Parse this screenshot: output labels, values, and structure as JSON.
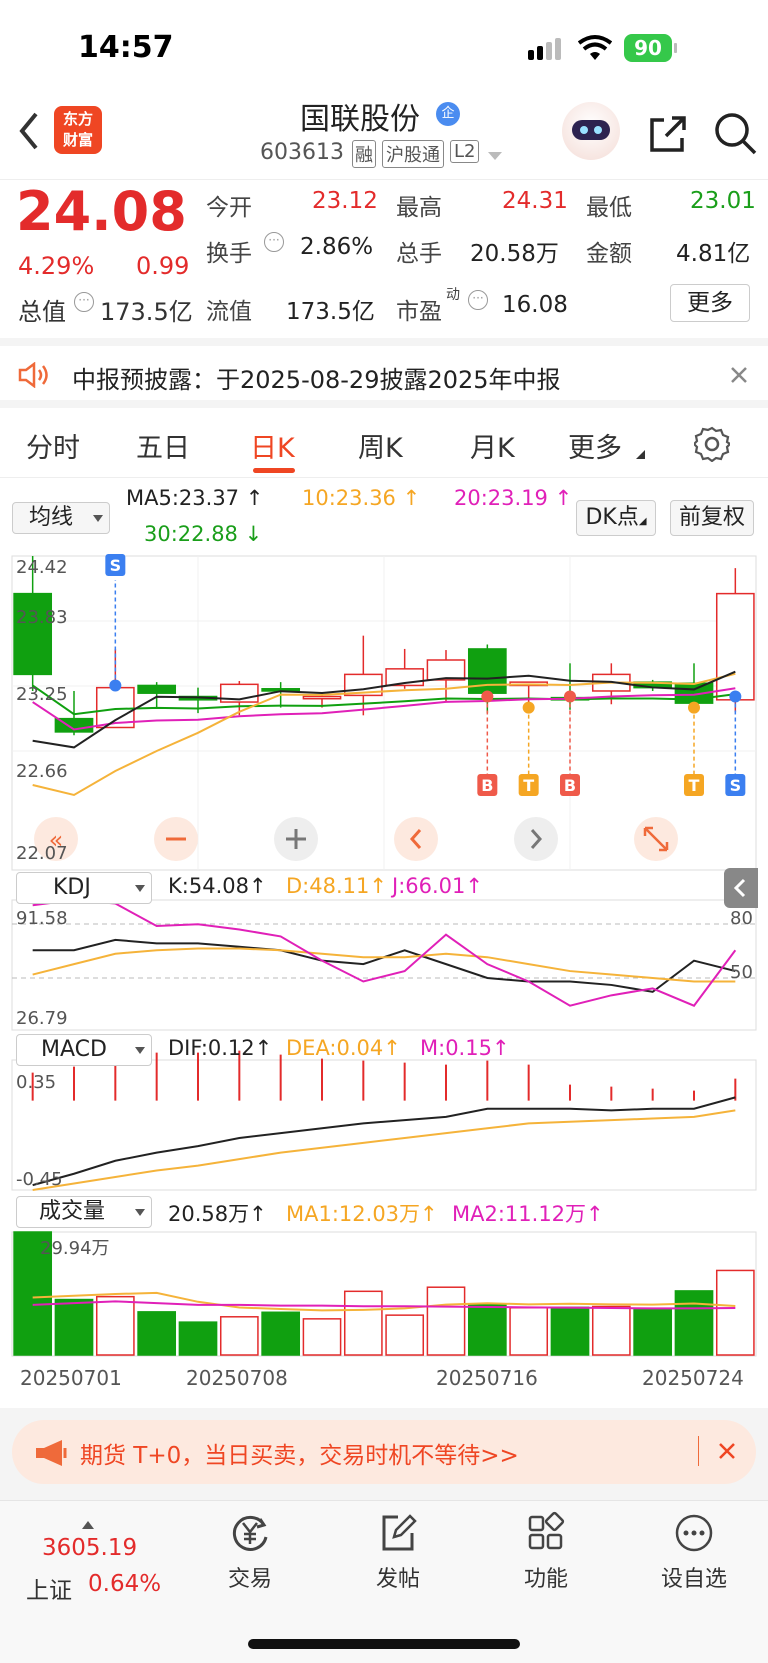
{
  "status": {
    "time": "14:57",
    "battery": "90"
  },
  "header": {
    "back": "‹",
    "logo_line1": "东方",
    "logo_line2": "财富",
    "stock_name": "国联股份",
    "name_badge": "企",
    "stock_code": "603613",
    "tags": [
      "融",
      "沪股通",
      "L2"
    ]
  },
  "quote": {
    "price": "24.08",
    "change_pct": "4.29%",
    "change": "0.99",
    "total_value_label": "总值",
    "total_value": "173.5亿",
    "fields": [
      {
        "label": "今开",
        "value": "23.12",
        "color": "red"
      },
      {
        "label": "最高",
        "value": "24.31",
        "color": "red"
      },
      {
        "label": "最低",
        "value": "23.01",
        "color": "green"
      },
      {
        "label": "换手",
        "value": "2.86%",
        "color": "dark"
      },
      {
        "label": "总手",
        "value": "20.58万",
        "color": "dark"
      },
      {
        "label": "金额",
        "value": "4.81亿",
        "color": "dark"
      },
      {
        "label": "流值",
        "value": "173.5亿",
        "color": "dark"
      },
      {
        "label": "市盈",
        "value": "16.08",
        "color": "dark"
      }
    ],
    "pe_sup": "动",
    "more_button": "更多"
  },
  "notice": {
    "text": "中报预披露：于2025-08-29披露2025年中报"
  },
  "tabs": [
    "分时",
    "五日",
    "日K",
    "周K",
    "月K",
    "更多"
  ],
  "active_tab": "日K",
  "ma": {
    "selector": "均线",
    "ma5": "MA5:23.37",
    "ma10": "10:23.36",
    "ma20": "20:23.19",
    "ma30": "30:22.88",
    "dk_button": "DK点",
    "adjust_button": "前复权"
  },
  "kline": {
    "y_labels": [
      "24.42",
      "23.83",
      "23.25",
      "22.66",
      "22.07"
    ],
    "markers": [
      "S",
      "B",
      "T",
      "B",
      "T",
      "S"
    ]
  },
  "kdj": {
    "selector": "KDJ",
    "k": "K:54.08",
    "d": "D:48.11",
    "j": "J:66.01",
    "y_top": "91.58",
    "y_bottom": "26.79",
    "r80": "80",
    "r50": "50"
  },
  "macd": {
    "selector": "MACD",
    "dif": "DIF:0.12",
    "dea": "DEA:0.04",
    "m": "M:0.15",
    "y_top": "0.35",
    "y_bottom": "-0.45"
  },
  "volume": {
    "selector": "成交量",
    "value": "20.58万",
    "ma1": "MA1:12.03万",
    "ma2": "MA2:11.12万",
    "y_top": "29.94万"
  },
  "dates": [
    "20250701",
    "20250708",
    "20250716",
    "20250724"
  ],
  "chart_data": {
    "type": "candlestick",
    "x": [
      "20250701",
      "20250702",
      "20250703",
      "20250704",
      "20250707",
      "20250708",
      "20250709",
      "20250710",
      "20250711",
      "20250714",
      "20250715",
      "20250716",
      "20250717",
      "20250718",
      "20250721",
      "20250722",
      "20250723",
      "20250724"
    ],
    "open": [
      24.08,
      22.95,
      22.87,
      23.25,
      23.15,
      23.1,
      23.22,
      23.13,
      23.16,
      23.25,
      23.3,
      23.58,
      23.25,
      23.14,
      23.2,
      23.28,
      23.27,
      23.12
    ],
    "close": [
      23.35,
      22.83,
      23.23,
      23.18,
      23.12,
      23.26,
      23.2,
      23.15,
      23.35,
      23.4,
      23.48,
      23.18,
      23.28,
      23.12,
      23.35,
      23.23,
      23.09,
      24.08
    ],
    "high": [
      24.42,
      23.2,
      23.58,
      23.28,
      23.23,
      23.29,
      23.28,
      23.18,
      23.7,
      23.58,
      23.57,
      23.62,
      23.28,
      23.45,
      23.45,
      23.3,
      23.45,
      24.31
    ],
    "low": [
      23.2,
      22.8,
      22.93,
      23.05,
      23.0,
      22.98,
      23.05,
      23.05,
      22.98,
      23.22,
      23.1,
      23.0,
      23.05,
      23.03,
      23.08,
      23.2,
      23.0,
      23.01
    ],
    "volume": [
      29.94,
      13.5,
      14.2,
      10.5,
      8.0,
      9.3,
      10.4,
      8.8,
      15.5,
      9.7,
      16.5,
      12.2,
      11.5,
      11.6,
      11.8,
      11.0,
      15.6,
      20.58
    ],
    "ylim": [
      22.07,
      24.42
    ],
    "vol_max": 29.94
  },
  "ad": {
    "text": "期货 T+0，当日买卖，交易时机不等待>>"
  },
  "bottom": {
    "index_value": "3605.19",
    "index_name": "上证",
    "index_change": "0.64%",
    "nav": [
      "交易",
      "发帖",
      "功能",
      "设自选"
    ]
  }
}
